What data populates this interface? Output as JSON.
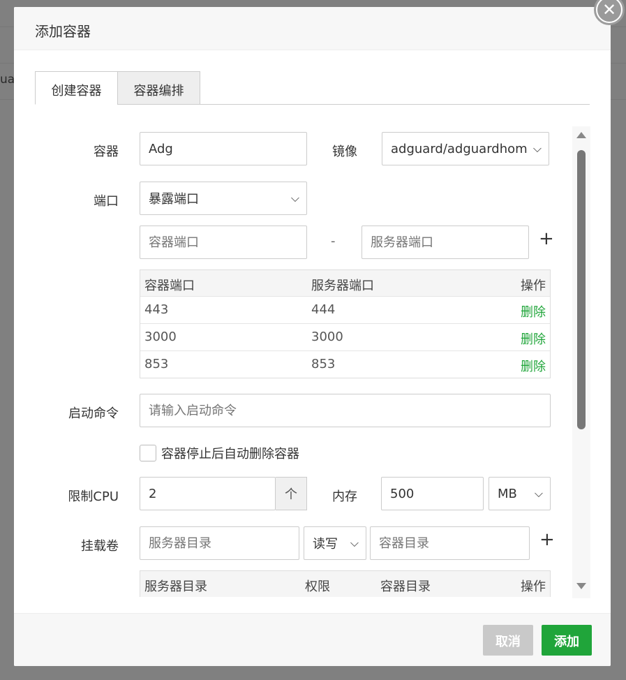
{
  "background": {
    "left_text": "ua"
  },
  "dialog": {
    "title": "添加容器",
    "close_symbol": "✕"
  },
  "tabs": [
    {
      "label": "创建容器",
      "active": true
    },
    {
      "label": "容器编排",
      "active": false
    }
  ],
  "form": {
    "container": {
      "label": "容器",
      "value": "Adg"
    },
    "image": {
      "label": "镜像",
      "value": "adguard/adguardhome"
    },
    "port": {
      "label": "端口",
      "mode": "暴露端口",
      "container_port_placeholder": "容器端口",
      "server_port_placeholder": "服务器端口",
      "separator": "-",
      "add_symbol": "+"
    },
    "port_table": {
      "headers": [
        "容器端口",
        "服务器端口",
        "操作"
      ],
      "rows": [
        {
          "container": "443",
          "server": "444",
          "action": "删除"
        },
        {
          "container": "3000",
          "server": "3000",
          "action": "删除"
        },
        {
          "container": "853",
          "server": "853",
          "action": "删除"
        }
      ]
    },
    "command": {
      "label": "启动命令",
      "placeholder": "请输入启动命令"
    },
    "auto_remove": {
      "label": "容器停止后自动删除容器",
      "checked": false
    },
    "cpu": {
      "label": "限制CPU",
      "value": "2",
      "stepper_symbol": "个"
    },
    "memory": {
      "label": "内存",
      "value": "500",
      "unit": "MB"
    },
    "volume": {
      "label": "挂载卷",
      "server_dir_placeholder": "服务器目录",
      "permission": "读写",
      "container_dir_placeholder": "容器目录",
      "add_symbol": "+"
    },
    "volume_table": {
      "headers": [
        "服务器目录",
        "权限",
        "容器目录",
        "操作"
      ]
    }
  },
  "footer": {
    "cancel_label": "取消",
    "add_label": "添加"
  },
  "colors": {
    "accent_green": "#20a53a",
    "disabled_gray": "#c9c9c9"
  }
}
